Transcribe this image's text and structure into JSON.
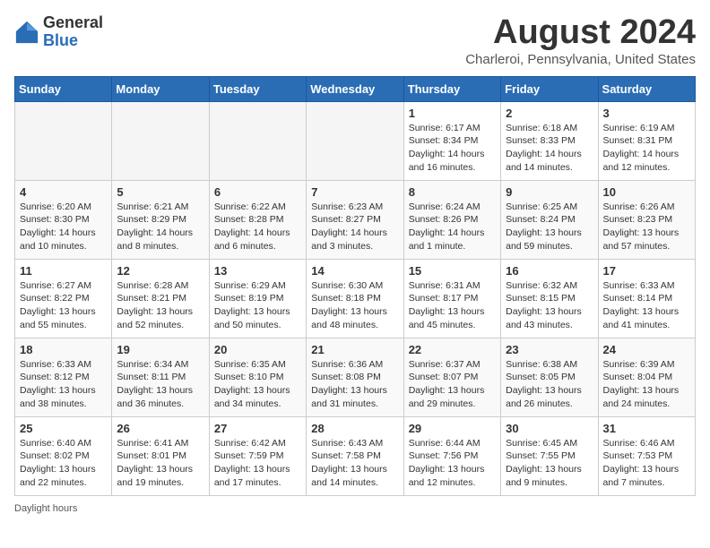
{
  "header": {
    "logo_general": "General",
    "logo_blue": "Blue",
    "month_title": "August 2024",
    "location": "Charleroi, Pennsylvania, United States"
  },
  "days_of_week": [
    "Sunday",
    "Monday",
    "Tuesday",
    "Wednesday",
    "Thursday",
    "Friday",
    "Saturday"
  ],
  "weeks": [
    [
      {
        "day": "",
        "info": ""
      },
      {
        "day": "",
        "info": ""
      },
      {
        "day": "",
        "info": ""
      },
      {
        "day": "",
        "info": ""
      },
      {
        "day": "1",
        "info": "Sunrise: 6:17 AM\nSunset: 8:34 PM\nDaylight: 14 hours\nand 16 minutes."
      },
      {
        "day": "2",
        "info": "Sunrise: 6:18 AM\nSunset: 8:33 PM\nDaylight: 14 hours\nand 14 minutes."
      },
      {
        "day": "3",
        "info": "Sunrise: 6:19 AM\nSunset: 8:31 PM\nDaylight: 14 hours\nand 12 minutes."
      }
    ],
    [
      {
        "day": "4",
        "info": "Sunrise: 6:20 AM\nSunset: 8:30 PM\nDaylight: 14 hours\nand 10 minutes."
      },
      {
        "day": "5",
        "info": "Sunrise: 6:21 AM\nSunset: 8:29 PM\nDaylight: 14 hours\nand 8 minutes."
      },
      {
        "day": "6",
        "info": "Sunrise: 6:22 AM\nSunset: 8:28 PM\nDaylight: 14 hours\nand 6 minutes."
      },
      {
        "day": "7",
        "info": "Sunrise: 6:23 AM\nSunset: 8:27 PM\nDaylight: 14 hours\nand 3 minutes."
      },
      {
        "day": "8",
        "info": "Sunrise: 6:24 AM\nSunset: 8:26 PM\nDaylight: 14 hours\nand 1 minute."
      },
      {
        "day": "9",
        "info": "Sunrise: 6:25 AM\nSunset: 8:24 PM\nDaylight: 13 hours\nand 59 minutes."
      },
      {
        "day": "10",
        "info": "Sunrise: 6:26 AM\nSunset: 8:23 PM\nDaylight: 13 hours\nand 57 minutes."
      }
    ],
    [
      {
        "day": "11",
        "info": "Sunrise: 6:27 AM\nSunset: 8:22 PM\nDaylight: 13 hours\nand 55 minutes."
      },
      {
        "day": "12",
        "info": "Sunrise: 6:28 AM\nSunset: 8:21 PM\nDaylight: 13 hours\nand 52 minutes."
      },
      {
        "day": "13",
        "info": "Sunrise: 6:29 AM\nSunset: 8:19 PM\nDaylight: 13 hours\nand 50 minutes."
      },
      {
        "day": "14",
        "info": "Sunrise: 6:30 AM\nSunset: 8:18 PM\nDaylight: 13 hours\nand 48 minutes."
      },
      {
        "day": "15",
        "info": "Sunrise: 6:31 AM\nSunset: 8:17 PM\nDaylight: 13 hours\nand 45 minutes."
      },
      {
        "day": "16",
        "info": "Sunrise: 6:32 AM\nSunset: 8:15 PM\nDaylight: 13 hours\nand 43 minutes."
      },
      {
        "day": "17",
        "info": "Sunrise: 6:33 AM\nSunset: 8:14 PM\nDaylight: 13 hours\nand 41 minutes."
      }
    ],
    [
      {
        "day": "18",
        "info": "Sunrise: 6:33 AM\nSunset: 8:12 PM\nDaylight: 13 hours\nand 38 minutes."
      },
      {
        "day": "19",
        "info": "Sunrise: 6:34 AM\nSunset: 8:11 PM\nDaylight: 13 hours\nand 36 minutes."
      },
      {
        "day": "20",
        "info": "Sunrise: 6:35 AM\nSunset: 8:10 PM\nDaylight: 13 hours\nand 34 minutes."
      },
      {
        "day": "21",
        "info": "Sunrise: 6:36 AM\nSunset: 8:08 PM\nDaylight: 13 hours\nand 31 minutes."
      },
      {
        "day": "22",
        "info": "Sunrise: 6:37 AM\nSunset: 8:07 PM\nDaylight: 13 hours\nand 29 minutes."
      },
      {
        "day": "23",
        "info": "Sunrise: 6:38 AM\nSunset: 8:05 PM\nDaylight: 13 hours\nand 26 minutes."
      },
      {
        "day": "24",
        "info": "Sunrise: 6:39 AM\nSunset: 8:04 PM\nDaylight: 13 hours\nand 24 minutes."
      }
    ],
    [
      {
        "day": "25",
        "info": "Sunrise: 6:40 AM\nSunset: 8:02 PM\nDaylight: 13 hours\nand 22 minutes."
      },
      {
        "day": "26",
        "info": "Sunrise: 6:41 AM\nSunset: 8:01 PM\nDaylight: 13 hours\nand 19 minutes."
      },
      {
        "day": "27",
        "info": "Sunrise: 6:42 AM\nSunset: 7:59 PM\nDaylight: 13 hours\nand 17 minutes."
      },
      {
        "day": "28",
        "info": "Sunrise: 6:43 AM\nSunset: 7:58 PM\nDaylight: 13 hours\nand 14 minutes."
      },
      {
        "day": "29",
        "info": "Sunrise: 6:44 AM\nSunset: 7:56 PM\nDaylight: 13 hours\nand 12 minutes."
      },
      {
        "day": "30",
        "info": "Sunrise: 6:45 AM\nSunset: 7:55 PM\nDaylight: 13 hours\nand 9 minutes."
      },
      {
        "day": "31",
        "info": "Sunrise: 6:46 AM\nSunset: 7:53 PM\nDaylight: 13 hours\nand 7 minutes."
      }
    ]
  ],
  "footer": "Daylight hours"
}
